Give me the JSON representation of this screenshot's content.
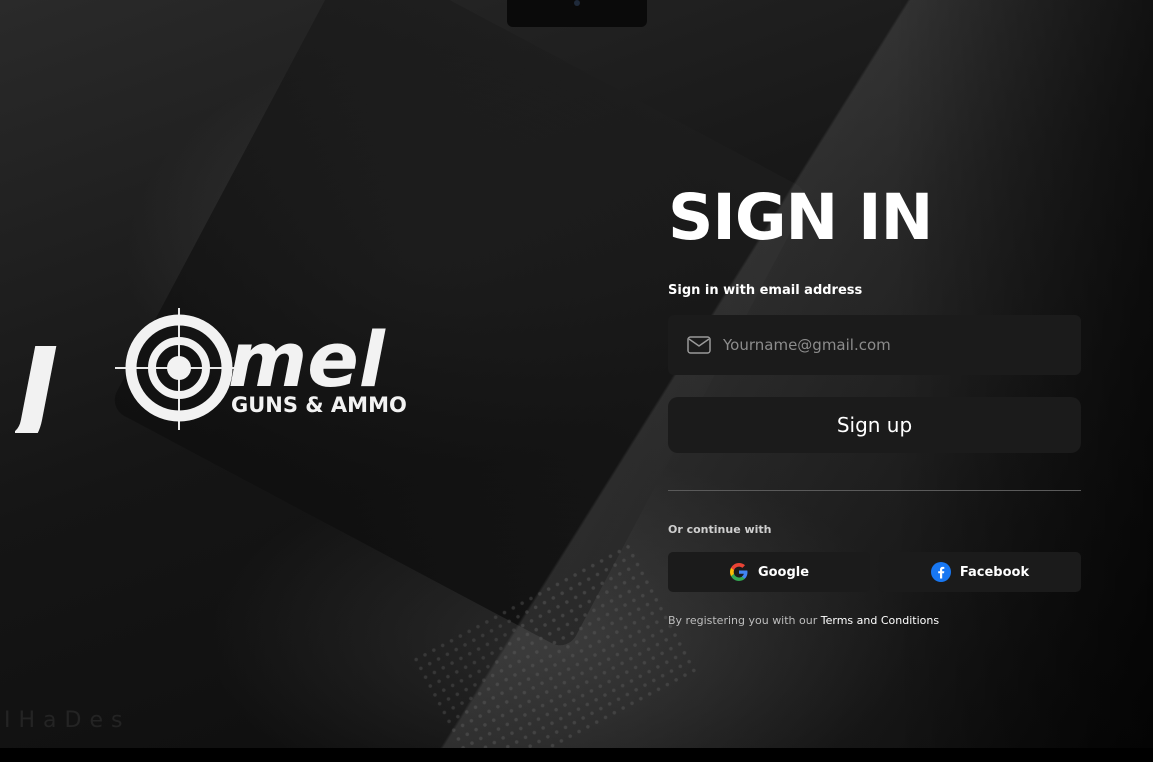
{
  "logo": {
    "wordmark_j": "J",
    "wordmark_rest": "mel",
    "tagline": "GUNS & AMMO"
  },
  "watermark": "IHaDes",
  "form": {
    "title": "SIGN IN",
    "subtitle": "Sign in with email address",
    "email": {
      "placeholder": "Yourname@gmail.com",
      "value": "",
      "icon": "mail-icon"
    },
    "signup_label": "Sign up",
    "continue_label": "Or continue with",
    "social": {
      "google_label": "Google",
      "google_icon": "google-icon",
      "facebook_label": "Facebook",
      "facebook_icon": "facebook-icon"
    },
    "terms_text": "By registering you with our ",
    "terms_link": "Terms and Conditions"
  },
  "colors": {
    "background": "#0d0d0d",
    "field": "#1b1b1b",
    "text": "#ffffff",
    "facebook": "#1877f2"
  }
}
